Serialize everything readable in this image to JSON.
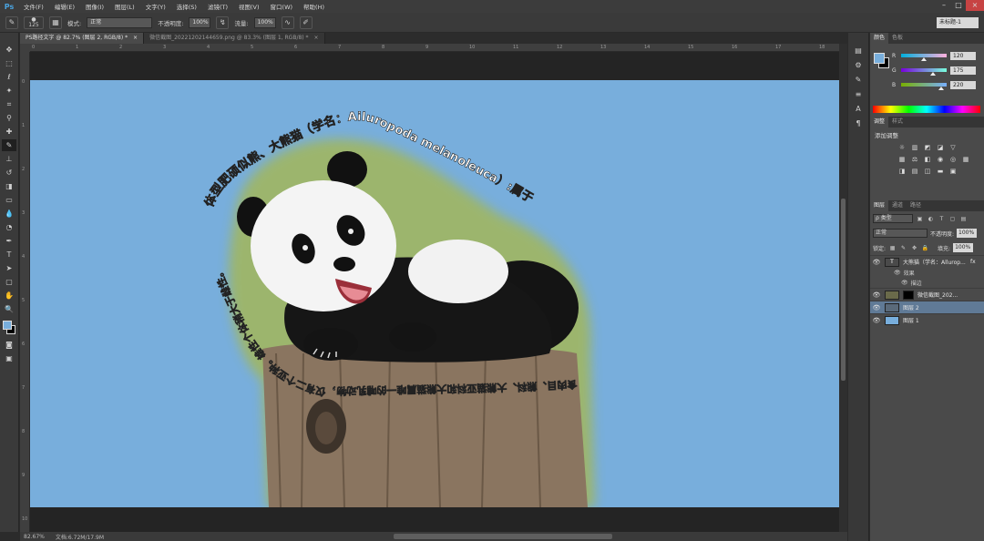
{
  "app": {
    "logo": "Ps",
    "menus": [
      "文件(F)",
      "编辑(E)",
      "图像(I)",
      "图层(L)",
      "文字(Y)",
      "选择(S)",
      "滤镜(T)",
      "视图(V)",
      "窗口(W)",
      "帮助(H)"
    ],
    "window_controls": [
      "–",
      "□",
      "×"
    ]
  },
  "options_bar": {
    "brush_size": "125",
    "mode_label": "模式:",
    "mode_value": "正常",
    "opacity_label": "不透明度:",
    "opacity_value": "100%",
    "flow_label": "流量:",
    "flow_value": "100%",
    "workspace": "未标题-1"
  },
  "tabs": [
    {
      "label": "PS路径文字 @ 82.7% (图层 2, RGB/8) *",
      "close": "×"
    },
    {
      "label": "微信截图_20221202144659.png @ 83.3% (图层 1, RGB/8) *",
      "close": "×"
    }
  ],
  "ruler": {
    "h_ticks": [
      "0",
      "1",
      "2",
      "3",
      "4",
      "5",
      "6",
      "7",
      "8",
      "9",
      "10",
      "11",
      "12",
      "13",
      "14",
      "15",
      "16",
      "17",
      "18"
    ],
    "v_ticks": [
      "0",
      "1",
      "2",
      "3",
      "4",
      "5",
      "6",
      "7",
      "8",
      "9",
      "10"
    ]
  },
  "canvas": {
    "path_text_top": "体型肥硕似熊、大熊猫（学名：Ailuropoda melanoleuca）:属于",
    "path_text_bottom": "食肉目、熊科、大熊猫亚科和大熊猫属唯一的哺乳动物，仅有二个亚种。雄性个体稍大于雌性。"
  },
  "status": {
    "zoom": "82.67%",
    "doc": "文档:6.72M/17.9M"
  },
  "color_panel": {
    "tabs": [
      "颜色",
      "色板"
    ],
    "r_label": "R",
    "g_label": "G",
    "b_label": "B",
    "r": "120",
    "g": "175",
    "b": "220",
    "fg_color": "#78aedc"
  },
  "adjust_panel": {
    "tabs": [
      "调整",
      "样式"
    ],
    "title": "添加调整"
  },
  "layers_panel": {
    "tabs": [
      "图层",
      "通道",
      "路径"
    ],
    "filter_type": "ρ 类型",
    "blend_mode": "正常",
    "opacity_label": "不透明度:",
    "opacity_value": "100%",
    "lock_label": "锁定:",
    "fill_label": "填充:",
    "fill_value": "100%",
    "layers": [
      {
        "name": "大熊猫（学名：Allurop...",
        "fx": "fx",
        "type": "T"
      },
      {
        "name": "微信截图_202...",
        "type": "img"
      },
      {
        "name": "图层 2",
        "type": "blank"
      },
      {
        "name": "图层 1",
        "type": "blue"
      }
    ],
    "effects_label": "效果",
    "stroke_label": "描边",
    "footer": [
      "GO",
      "fx",
      "◐",
      "▭",
      "▤",
      "🗑"
    ]
  }
}
